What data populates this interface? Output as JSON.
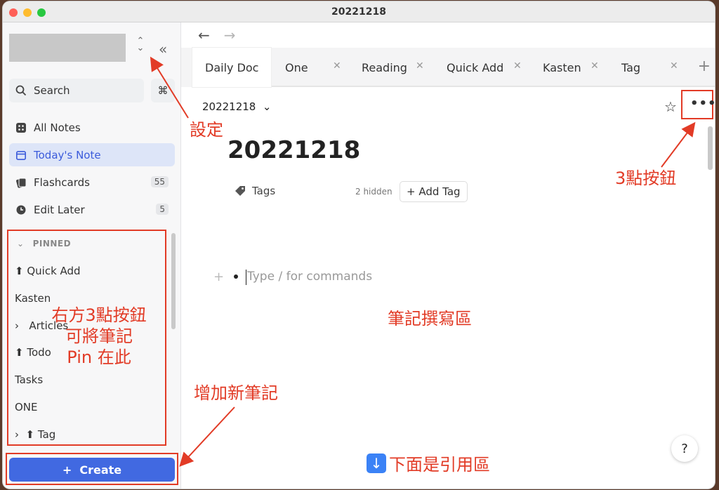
{
  "window": {
    "title": "20221218"
  },
  "sidebar": {
    "search_label": "Search",
    "cmd_glyph": "⌘",
    "nav": [
      {
        "label": "All Notes"
      },
      {
        "label": "Today's Note"
      },
      {
        "label": "Flashcards",
        "count": "55"
      },
      {
        "label": "Edit Later",
        "count": "5"
      }
    ],
    "pinned_header": "PINNED",
    "pinned": [
      {
        "label": "Quick Add"
      },
      {
        "label": "Kasten"
      },
      {
        "label": "Articles"
      },
      {
        "label": "Todo"
      },
      {
        "label": "Tasks"
      },
      {
        "label": "ONE"
      },
      {
        "label": "Tag"
      }
    ],
    "create_label": "Create"
  },
  "tabs": [
    {
      "label": "Daily Doc"
    },
    {
      "label": "One"
    },
    {
      "label": "Reading"
    },
    {
      "label": "Quick Add"
    },
    {
      "label": "Kasten"
    },
    {
      "label": "Tag"
    }
  ],
  "doc": {
    "breadcrumb": "20221218",
    "title": "20221218",
    "tags_label": "Tags",
    "hidden_count": "2 hidden",
    "add_tag_label": "Add Tag",
    "editor_placeholder": "Type / for commands"
  },
  "annotations": {
    "settings": "設定",
    "three_dots": "3點按鈕",
    "pin_note": [
      "右方3點按鈕",
      "可將筆記",
      "Pin 在此"
    ],
    "writing_area": "筆記撰寫區",
    "add_note": "增加新筆記",
    "below_ref": "下面是引用區",
    "color": "#e23b26"
  },
  "colors": {
    "accent": "#4169e1",
    "active_bg": "#dde5f8"
  }
}
